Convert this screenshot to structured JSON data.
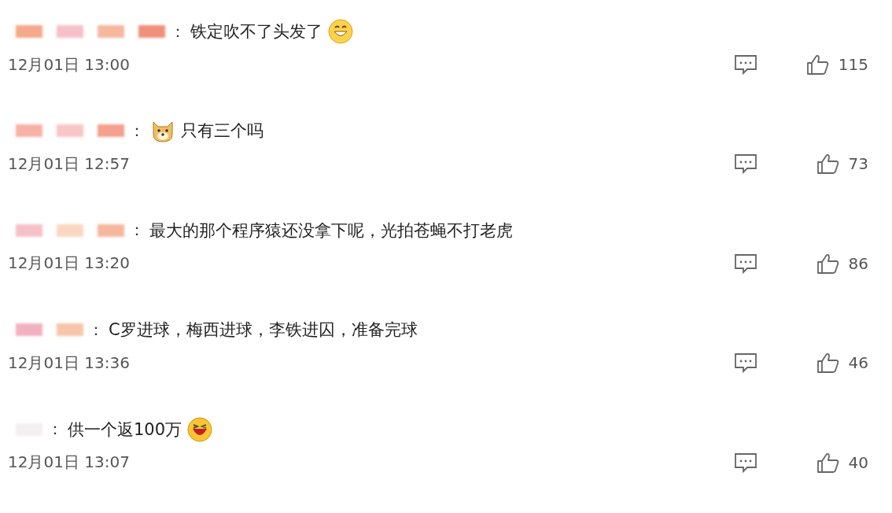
{
  "comments": [
    {
      "name_blocks": [
        {
          "color": "#f5a88a"
        },
        {
          "color": "#f7c0c8"
        },
        {
          "color": "#f5b7a0"
        },
        {
          "color": "#f08f7a"
        }
      ],
      "separator": "：",
      "parts": [
        {
          "kind": "text",
          "text": "铁定吹不了头发了"
        },
        {
          "kind": "grin"
        }
      ],
      "time": "12月01日 13:00",
      "likes": "115"
    },
    {
      "name_blocks": [
        {
          "color": "#f7b2a8"
        },
        {
          "color": "#f8c6c6"
        },
        {
          "color": "#f3a08e"
        }
      ],
      "separator": "：",
      "parts": [
        {
          "kind": "dog"
        },
        {
          "kind": "text",
          "text": "只有三个吗"
        }
      ],
      "time": "12月01日 12:57",
      "likes": "73"
    },
    {
      "name_blocks": [
        {
          "color": "#f6c0c8"
        },
        {
          "color": "#fbd7c3"
        },
        {
          "color": "#f5b79e"
        }
      ],
      "separator": "：",
      "parts": [
        {
          "kind": "text",
          "text": "最大的那个程序猿还没拿下呢，光拍苍蝇不打老虎"
        }
      ],
      "time": "12月01日 13:20",
      "likes": "86"
    },
    {
      "name_blocks": [
        {
          "color": "#f2b1bf"
        },
        {
          "color": "#f7c6a8"
        }
      ],
      "separator": "：",
      "parts": [
        {
          "kind": "text",
          "text": "C罗进球，梅西进球，李铁进囚，准备完球"
        }
      ],
      "time": "12月01日 13:36",
      "likes": "46"
    },
    {
      "name_blocks": [
        {
          "color": "#f3eef0"
        }
      ],
      "separator": "：",
      "parts": [
        {
          "kind": "text",
          "text": "供一个返100万"
        },
        {
          "kind": "laugh"
        }
      ],
      "time": "12月01日 13:07",
      "likes": "40"
    }
  ]
}
